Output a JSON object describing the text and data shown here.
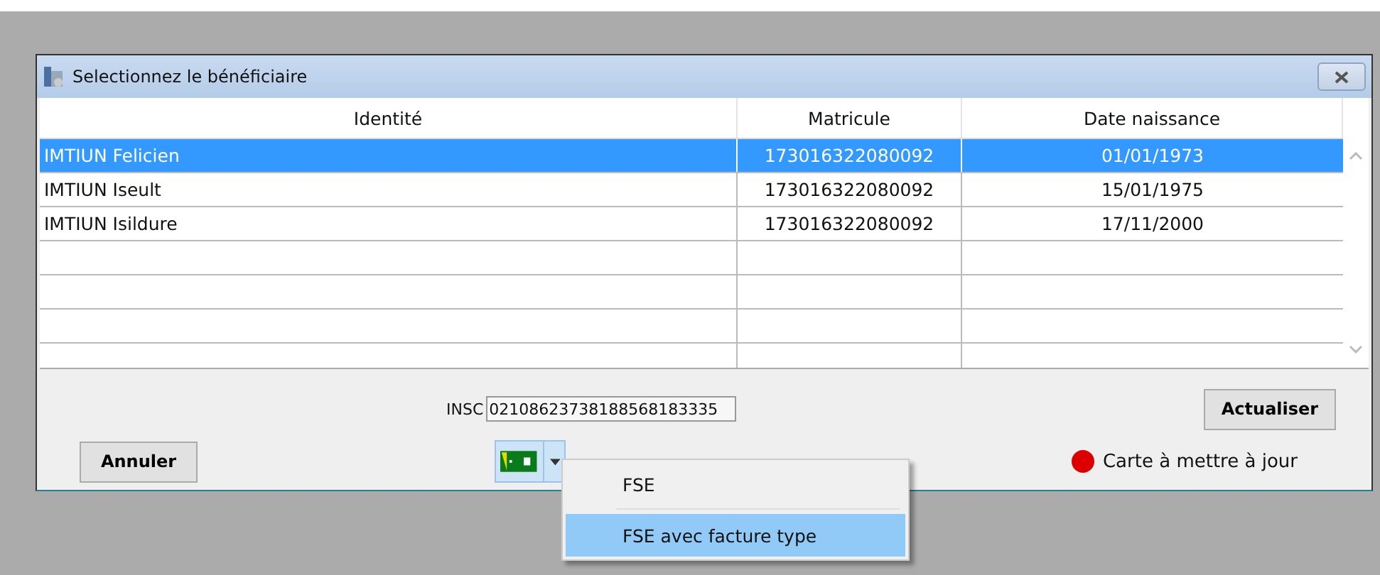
{
  "window": {
    "title": "Selectionnez le bénéficiaire"
  },
  "table": {
    "columns": [
      "Identité",
      "Matricule",
      "Date naissance"
    ],
    "rows": [
      {
        "cells": [
          "IMTIUN Felicien",
          "173016322080092",
          "01/01/1973"
        ],
        "selected": true
      },
      {
        "cells": [
          "IMTIUN Iseult",
          "173016322080092",
          "15/01/1975"
        ],
        "selected": false
      },
      {
        "cells": [
          "IMTIUN Isildure",
          "173016322080092",
          "17/11/2000"
        ],
        "selected": false
      }
    ]
  },
  "insc": {
    "label": "INSC",
    "value": "02108623738188568183335"
  },
  "buttons": {
    "refresh": "Actualiser",
    "cancel": "Annuler"
  },
  "status": {
    "color": "#dd0000",
    "text": "Carte à mettre à jour"
  },
  "menu": {
    "items": [
      {
        "label": "FSE",
        "selected": false
      },
      {
        "label": "FSE avec facture type",
        "selected": true
      }
    ]
  }
}
